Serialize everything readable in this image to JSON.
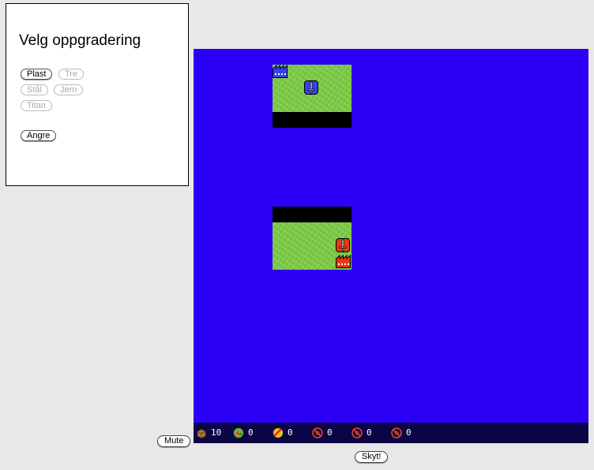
{
  "panel": {
    "title": "Velg oppgradering",
    "upgrades": [
      {
        "label": "Plast",
        "enabled": true
      },
      {
        "label": "Tre",
        "enabled": false
      },
      {
        "label": "Stål",
        "enabled": false
      },
      {
        "label": "Jern",
        "enabled": false
      },
      {
        "label": "Titan",
        "enabled": false
      }
    ],
    "undo_label": "Angre"
  },
  "board": {
    "colors": {
      "sea": "#2c00f5",
      "grass": "#7cc944",
      "player_blue": "#3344ee",
      "player_red": "#e83a10"
    },
    "units": [
      {
        "team": "blue",
        "type": "sword",
        "icon": "sword-icon"
      },
      {
        "team": "red",
        "type": "sword",
        "icon": "sword-icon"
      }
    ],
    "factories": [
      {
        "team": "blue",
        "icon": "factory-icon"
      },
      {
        "team": "red",
        "icon": "factory-icon"
      }
    ]
  },
  "status": {
    "resources": [
      {
        "icon": "crate-icon",
        "value": "10"
      },
      {
        "icon": "grass-tile-icon",
        "value": "0"
      },
      {
        "icon": "torpedo-icon",
        "value": "0"
      },
      {
        "icon": "blocked-bomb-icon",
        "value": "0"
      },
      {
        "icon": "blocked-bomb-icon",
        "value": "0"
      },
      {
        "icon": "blocked-bomb-icon",
        "value": "0"
      }
    ]
  },
  "controls": {
    "mute_label": "Mute",
    "fire_label": "Skyt!"
  }
}
